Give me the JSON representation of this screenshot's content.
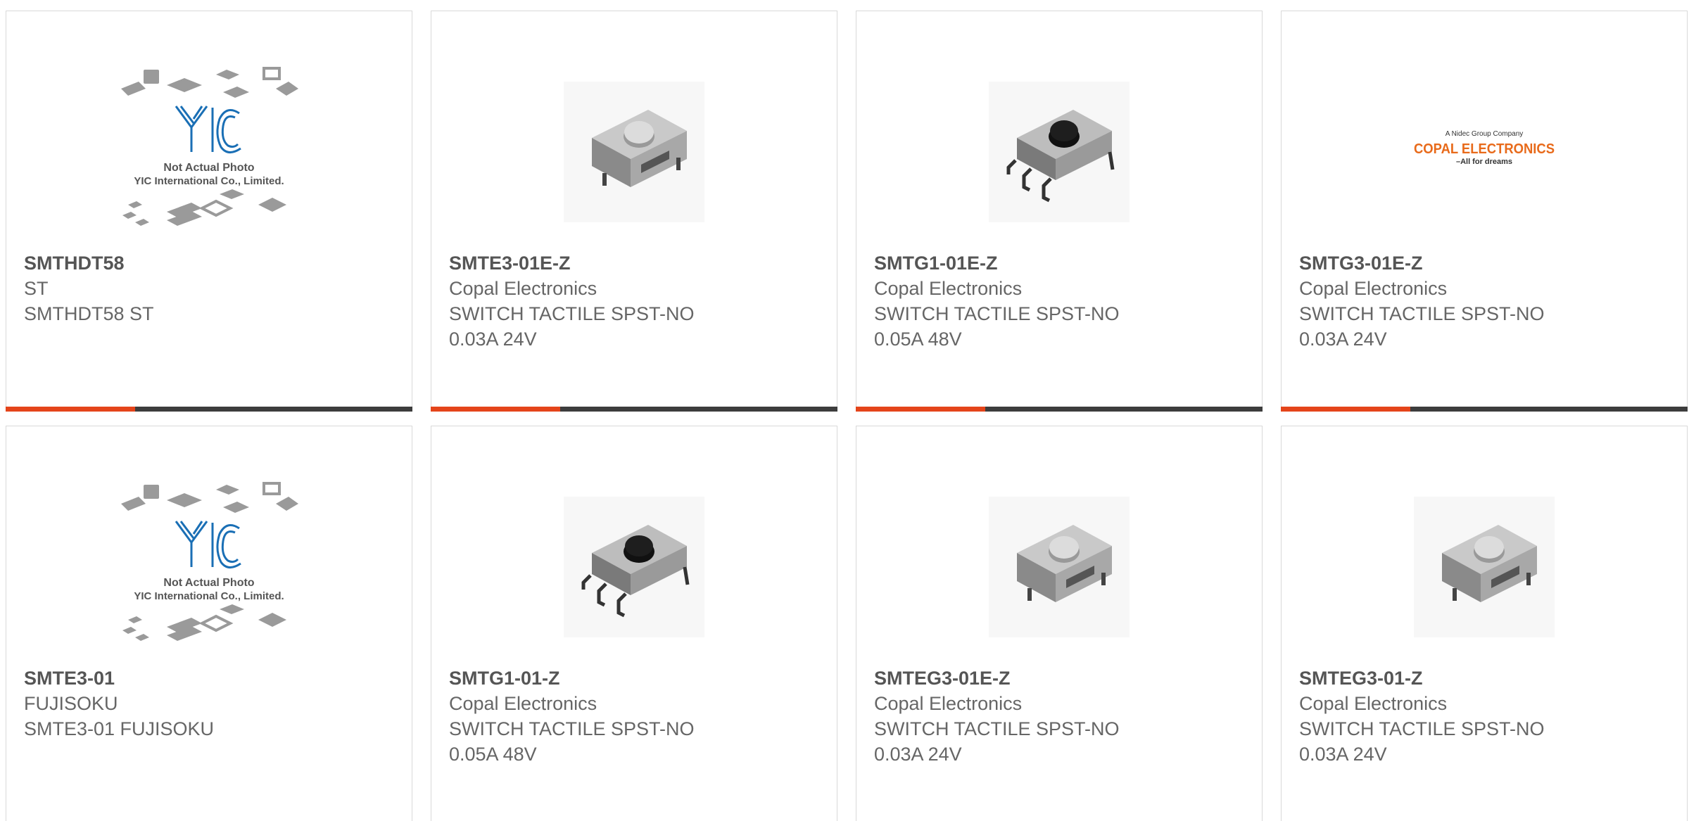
{
  "colors": {
    "accent": "#e4441a",
    "bar": "#3d3d3d",
    "border": "#d9d9d9",
    "text": "#666666",
    "yic_blue": "#1a6fb5",
    "copal_orange": "#e86a1a"
  },
  "placeholder": {
    "caption_line1": "Not Actual Photo",
    "caption_line2": "YIC International Co., Limited.",
    "logo_text": "YIC"
  },
  "copal_logo": {
    "tagline_top": "A Nidec Group Company",
    "name": "COPAL ELECTRONICS",
    "tagline_bottom": "–All for dreams"
  },
  "products": [
    {
      "part_number": "SMTHDT58",
      "manufacturer": "ST",
      "description": "SMTHDT58 ST",
      "rating": "",
      "image": "yic-placeholder"
    },
    {
      "part_number": "SMTE3-01E-Z",
      "manufacturer": "Copal Electronics",
      "description": "SWITCH TACTILE SPST-NO",
      "rating": "0.03A 24V",
      "image": "tactile-switch-white"
    },
    {
      "part_number": "SMTG1-01E-Z",
      "manufacturer": "Copal Electronics",
      "description": "SWITCH TACTILE SPST-NO",
      "rating": "0.05A 48V",
      "image": "tactile-switch-black"
    },
    {
      "part_number": "SMTG3-01E-Z",
      "manufacturer": "Copal Electronics",
      "description": "SWITCH TACTILE SPST-NO",
      "rating": "0.03A 24V",
      "image": "copal-logo"
    },
    {
      "part_number": "SMTE3-01",
      "manufacturer": "FUJISOKU",
      "description": "SMTE3-01 FUJISOKU",
      "rating": "",
      "image": "yic-placeholder"
    },
    {
      "part_number": "SMTG1-01-Z",
      "manufacturer": "Copal Electronics",
      "description": "SWITCH TACTILE SPST-NO",
      "rating": "0.05A 48V",
      "image": "tactile-switch-black"
    },
    {
      "part_number": "SMTEG3-01E-Z",
      "manufacturer": "Copal Electronics",
      "description": "SWITCH TACTILE SPST-NO",
      "rating": "0.03A 24V",
      "image": "tactile-switch-white"
    },
    {
      "part_number": "SMTEG3-01-Z",
      "manufacturer": "Copal Electronics",
      "description": "SWITCH TACTILE SPST-NO",
      "rating": "0.03A 24V",
      "image": "tactile-switch-white"
    }
  ]
}
